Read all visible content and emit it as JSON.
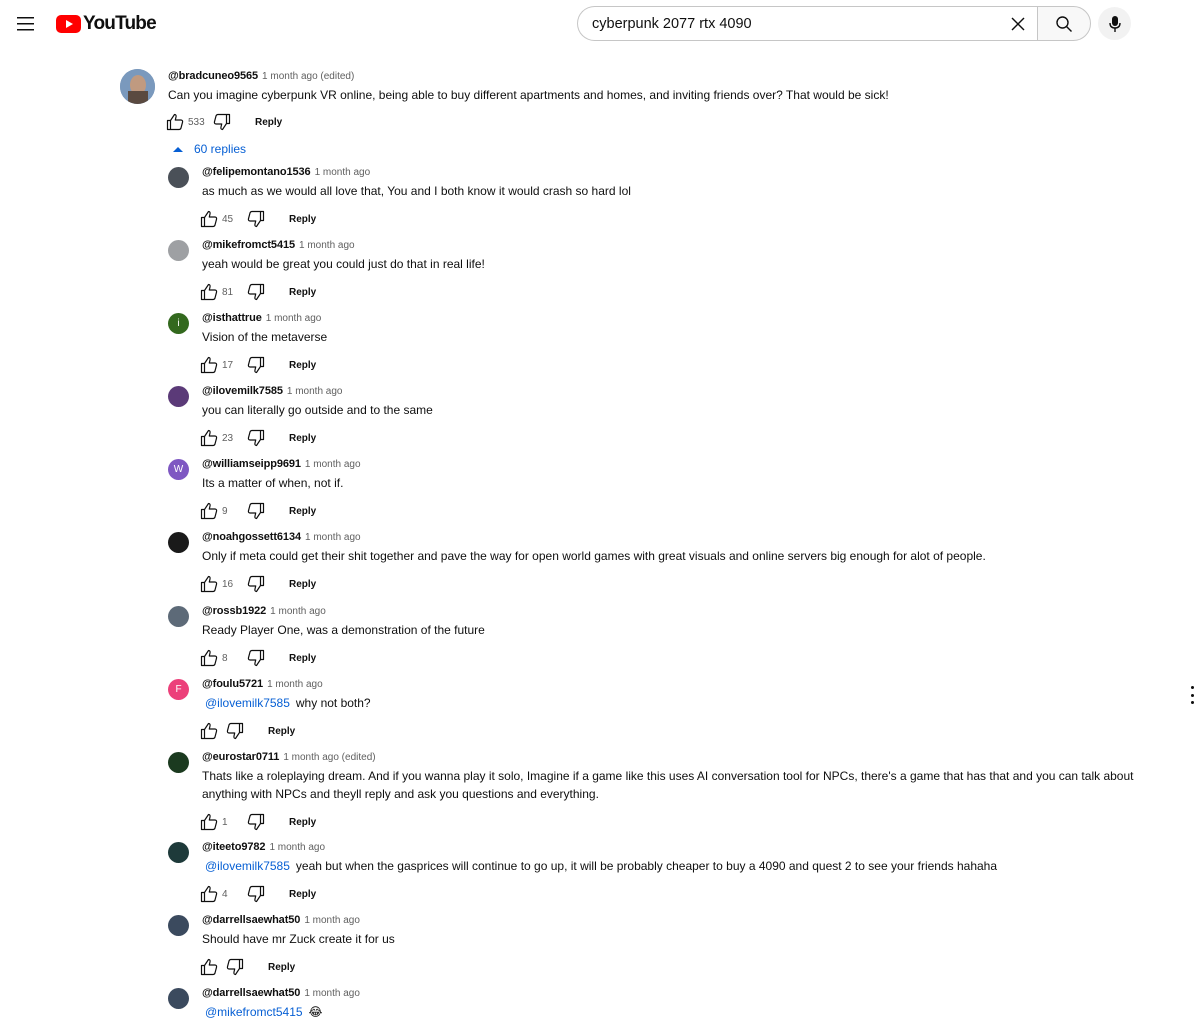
{
  "header": {
    "logo_text": "YouTube",
    "search": {
      "value": "cyberpunk 2077 rtx 4090",
      "placeholder": "Search"
    }
  },
  "top_comment": {
    "author": "@bradcuneo9565",
    "time": "1 month ago (edited)",
    "text": "Can you imagine cyberpunk VR online, being able to buy different apartments and homes, and inviting friends over? That would be sick!",
    "likes": "533",
    "reply_label": "Reply"
  },
  "replies_toggle": {
    "label": "60 replies"
  },
  "replies": [
    {
      "author": "@felipemontano1536",
      "time": "1 month ago",
      "mention": "",
      "text": "as much as we would all love that, You and I both know it would crash so hard lol",
      "likes": "45",
      "reply_label": "Reply",
      "avatar": {
        "letter": "",
        "color": "#4a5058"
      }
    },
    {
      "author": "@mikefromct5415",
      "time": "1 month ago",
      "mention": "",
      "text": "yeah would be great you could just do that in real life!",
      "likes": "81",
      "reply_label": "Reply",
      "avatar": {
        "letter": "",
        "color": "#9ea0a3"
      }
    },
    {
      "author": "@isthattrue",
      "time": "1 month ago",
      "mention": "",
      "text": "Vision of the metaverse",
      "likes": "17",
      "reply_label": "Reply",
      "avatar": {
        "letter": "i",
        "color": "#33691e"
      }
    },
    {
      "author": "@ilovemilk7585",
      "time": "1 month ago",
      "mention": "",
      "text": "you can literally go outside and to the same",
      "likes": "23",
      "reply_label": "Reply",
      "avatar": {
        "letter": "",
        "color": "#5b3a78"
      }
    },
    {
      "author": "@williamseipp9691",
      "time": "1 month ago",
      "mention": "",
      "text": "Its a matter of when, not if.",
      "likes": "9",
      "reply_label": "Reply",
      "avatar": {
        "letter": "W",
        "color": "#7e57c2"
      }
    },
    {
      "author": "@noahgossett6134",
      "time": "1 month ago",
      "mention": "",
      "text": "Only if meta could get their shit together and pave the way for open world games with great visuals and online servers big enough for alot of people.",
      "likes": "16",
      "reply_label": "Reply",
      "avatar": {
        "letter": "",
        "color": "#1a1a1a"
      }
    },
    {
      "author": "@rossb1922",
      "time": "1 month ago",
      "mention": "",
      "text": "Ready Player One, was a demonstration of the future",
      "likes": "8",
      "reply_label": "Reply",
      "avatar": {
        "letter": "",
        "color": "#5d6a78"
      }
    },
    {
      "author": "@foulu5721",
      "time": "1 month ago",
      "mention": "@ilovemilk7585",
      "text": "why not both?",
      "likes": "",
      "reply_label": "Reply",
      "avatar": {
        "letter": "F",
        "color": "#ec407a"
      }
    },
    {
      "author": "@eurostar0711",
      "time": "1 month ago (edited)",
      "mention": "",
      "text": "Thats like a roleplaying dream. And if you wanna play it solo, Imagine if a game like this uses AI conversation tool for NPCs, there's a game that has that and you can talk about anything with NPCs and theyll reply and ask you questions and everything.",
      "likes": "1",
      "reply_label": "Reply",
      "avatar": {
        "letter": "",
        "color": "#1b3a1f"
      }
    },
    {
      "author": "@iteeto9782",
      "time": "1 month ago",
      "mention": "@ilovemilk7585",
      "text": "yeah but when the gasprices will continue to go up, it will be probably cheaper to buy a 4090 and quest 2 to see your friends hahaha",
      "likes": "4",
      "reply_label": "Reply",
      "avatar": {
        "letter": "",
        "color": "#1e3a3a"
      }
    },
    {
      "author": "@darrellsaewhat50",
      "time": "1 month ago",
      "mention": "",
      "text": "Should have mr Zuck create it for us",
      "likes": "",
      "reply_label": "Reply",
      "avatar": {
        "letter": "",
        "color": "#3b4a5e"
      }
    },
    {
      "author": "@darrellsaewhat50",
      "time": "1 month ago",
      "mention": "@mikefromct5415",
      "text": "😂",
      "likes": "",
      "reply_label": "",
      "avatar": {
        "letter": "",
        "color": "#3b4a5e"
      }
    }
  ]
}
